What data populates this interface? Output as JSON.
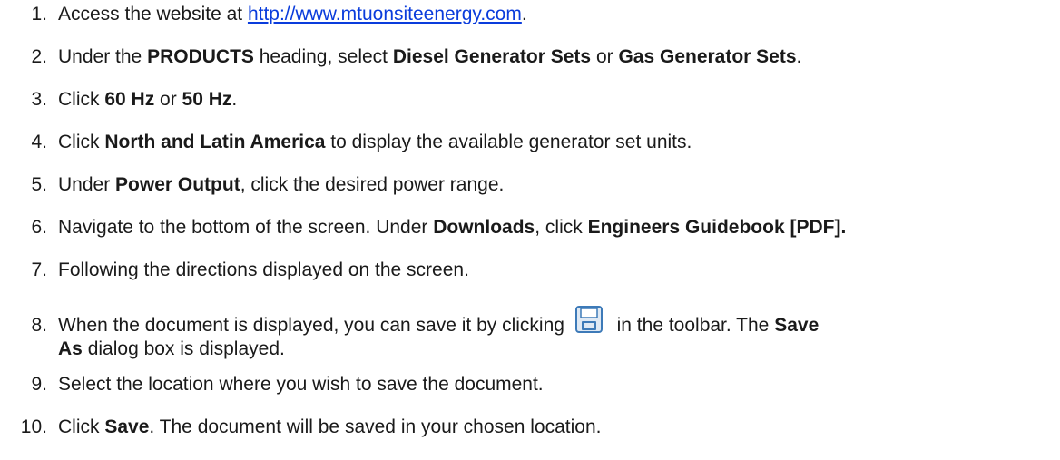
{
  "steps": [
    {
      "num": "1.",
      "pre": "Access the website at ",
      "link": "http://www.mtuonsiteenergy.com",
      "post": "."
    },
    {
      "num": "2.",
      "t1": "Under the ",
      "b1": "PRODUCTS",
      "t2": " heading, select ",
      "b2": "Diesel Generator Sets",
      "t3": " or ",
      "b3": "Gas Generator Sets",
      "t4": "."
    },
    {
      "num": "3.",
      "t1": "Click ",
      "b1": "60 Hz",
      "t2": " or ",
      "b2": "50 Hz",
      "t3": "."
    },
    {
      "num": "4.",
      "t1": "Click ",
      "b1": "North and Latin America",
      "t2": " to display the available generator set units."
    },
    {
      "num": "5.",
      "t1": "Under ",
      "b1": "Power Output",
      "t2": ", click the desired power range."
    },
    {
      "num": "6.",
      "t1": "Navigate to the bottom of the screen. Under ",
      "b1": "Downloads",
      "t2": ", click ",
      "b2": "Engineers Guidebook [PDF]."
    },
    {
      "num": "7.",
      "t1": "Following the directions displayed on the screen."
    },
    {
      "num": "8.",
      "t1": "When the document is displayed, you can save it by clicking ",
      "icon": "save-icon",
      "t2": " in the toolbar. The ",
      "b1": "Save",
      "b2": "As",
      "t3": " dialog box is displayed."
    },
    {
      "num": "9.",
      "t1": "Select the location where you wish to save the document."
    },
    {
      "num": "10.",
      "t1": "Click ",
      "b1": "Save",
      "t2": ". The document will be saved in your chosen location."
    }
  ],
  "colors": {
    "text": "#1a1a1a",
    "link": "#0a3cdc",
    "icon_blue": "#3d7ab8",
    "icon_light": "#dfe9f4"
  }
}
